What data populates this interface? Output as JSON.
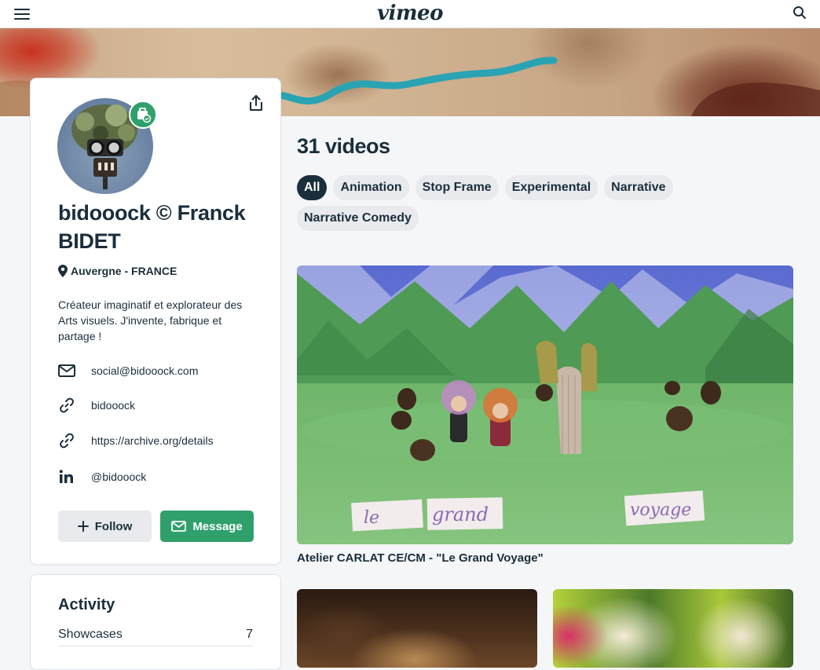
{
  "header": {
    "logo": "vimeo",
    "menu_icon": "hamburger-icon",
    "search_icon": "search-icon"
  },
  "profile": {
    "name": "bidooock © Franck BIDET",
    "location": "Auvergne - FRANCE",
    "bio": "Créateur imaginatif et explorateur des Arts visuels. J'invente, fabrique et partage !",
    "links": [
      {
        "icon": "mail-icon",
        "text": "social@bidooock.com"
      },
      {
        "icon": "link-icon",
        "text": "bidooock"
      },
      {
        "icon": "link-icon",
        "text": "https://archive.org/details"
      },
      {
        "icon": "linkedin-icon",
        "text": "@bidooock"
      }
    ],
    "follow_label": "Follow",
    "message_label": "Message"
  },
  "activity": {
    "title": "Activity",
    "rows": [
      {
        "label": "Showcases",
        "count": "7"
      }
    ]
  },
  "main": {
    "videos_title": "31 videos",
    "filters": [
      "All",
      "Animation",
      "Stop Frame",
      "Experimental",
      "Narrative",
      "Narrative Comedy"
    ],
    "active_filter": "All",
    "featured_video": {
      "title": "Atelier CARLAT CE/CM - \"Le Grand Voyage\"",
      "sign_words": [
        "le",
        "grand",
        "voyage"
      ]
    }
  },
  "colors": {
    "text": "#1a2e3b",
    "accent_green": "#2fa06c",
    "chip_bg": "#e8eaed",
    "page_bg": "#f5f6f8"
  }
}
